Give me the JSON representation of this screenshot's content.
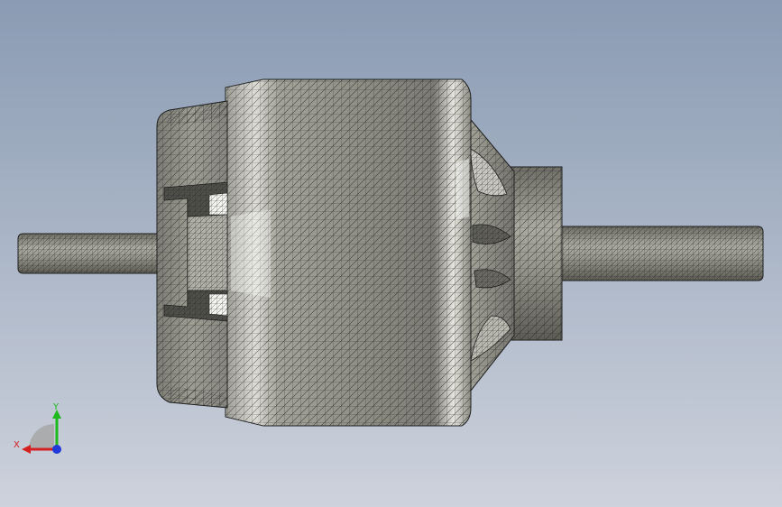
{
  "viewport": {
    "background_top": "#8a9bb3",
    "background_bottom": "#cdd2dc",
    "model": {
      "name": "motor-rotor-mesh",
      "surface_color": "#8f8f86",
      "highlight_color": "#ffffff",
      "mesh_line_color": "#1e1e1e"
    }
  },
  "triad": {
    "x_label": "X",
    "y_label": "Y",
    "x_color": "#d42020",
    "y_color": "#1fb81f",
    "z_color": "#1f3ad8"
  }
}
